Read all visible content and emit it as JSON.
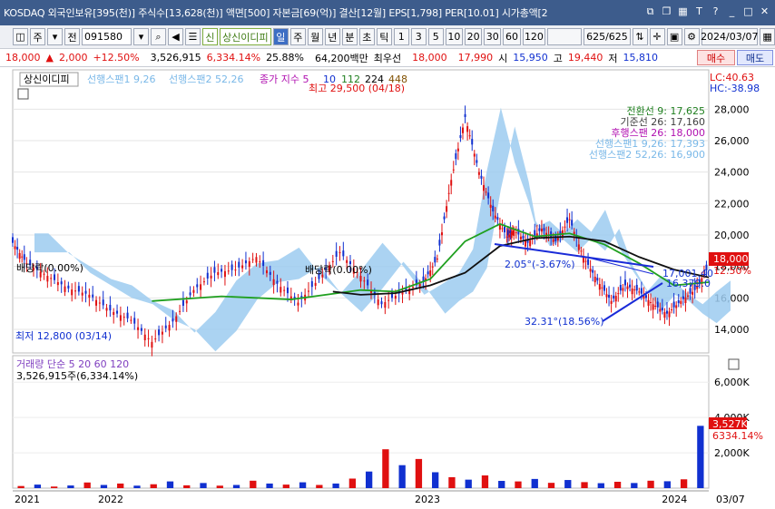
{
  "window": {
    "title": "KOSDAQ 외국인보유[395(천)] 주식수[13,628(천)] 액면[500] 자본금[69(억)] 결산[12월] EPS[1,798] PER[10.01] 시가총액[2",
    "ctrl_icons": [
      "restore-icon",
      "copy-icon",
      "grid-icon",
      "text-icon",
      "help-icon",
      "minimize-icon",
      "maximize-icon",
      "close-icon"
    ]
  },
  "toolbar": {
    "period": "주",
    "mode": "전",
    "code": "091580",
    "name": "상신이디피",
    "credit": "신",
    "intervals": [
      "일",
      "주",
      "월",
      "년",
      "분",
      "초",
      "틱"
    ],
    "numbers": [
      "1",
      "3",
      "5",
      "10",
      "20",
      "30",
      "60",
      "120"
    ],
    "count": "625/625",
    "date": "2024/03/07"
  },
  "info": {
    "price": "18,000",
    "change": "2,000",
    "change_pct": "+12.50%",
    "volume": "3,526,915",
    "vol_pct": "6,334.14%",
    "ratio": "25.88%",
    "amount": "64,200백만",
    "best_bid_label": "최우선",
    "ask": "18,000",
    "bid": "17,990",
    "open_label": "시",
    "open": "15,950",
    "high_label": "고",
    "high": "19,440",
    "low_label": "저",
    "low": "15,810",
    "buy": "매수",
    "sell": "매도"
  },
  "legend": {
    "name": "상신이디피",
    "span1": "선행스팬1 9,26",
    "span2": "선행스팬2 52,26",
    "ma_label": "종가 지수 5",
    "ma10": "10",
    "ma112": "112",
    "ma224": "224",
    "ma448": "448",
    "lc": "LC:40.63",
    "hc": "HC:-38.98"
  },
  "ichimoku_legend": [
    "전환선 9: 17,625",
    "기준선 26: 17,160",
    "후행스팬 26: 18,000",
    "선행스팬1 9,26: 17,393",
    "선행스팬2 52,26: 16,900"
  ],
  "annotations": {
    "high": "최고 29,500 (04/18)",
    "low": "최저 12,800 (03/14)",
    "div1": "배당락(0.00%)",
    "div2": "배당락(0.00%)",
    "angle1": "2.05°(-3.67%)",
    "angle2": "32.31°(18.56%)",
    "line1": "17,001.40",
    "line2": "16,379.0"
  },
  "price_badge": {
    "price": "18,000",
    "pct": "12.50%"
  },
  "volume": {
    "legend": "거래량 단순 5 20 60 120",
    "amount": "3,526,915주(6,334.14%)",
    "badge1": "3,527K",
    "badge2": "6334.14%"
  },
  "chart_data": {
    "type": "line",
    "title": "",
    "y_ticks": [
      14000,
      16000,
      18000,
      20000,
      22000,
      24000,
      26000,
      28000
    ],
    "ylim": [
      12500,
      30500
    ],
    "vol_ticks": [
      "2,000K",
      "4,000K",
      "6,000K"
    ],
    "vol_ylim": [
      0,
      7500
    ],
    "x_labels": [
      "2021",
      "2022",
      "2023",
      "2024",
      "03/07"
    ],
    "x_label_t": [
      0,
      0.12,
      0.575,
      0.93,
      1.0
    ],
    "series": [
      {
        "t": [
          0,
          0.02,
          0.05,
          0.08,
          0.11,
          0.14,
          0.17,
          0.2,
          0.23,
          0.26,
          0.29,
          0.32,
          0.35,
          0.38,
          0.41,
          0.44,
          0.47,
          0.5,
          0.53,
          0.56,
          0.59,
          0.61,
          0.63,
          0.65,
          0.67,
          0.69,
          0.71,
          0.72,
          0.74,
          0.76,
          0.78,
          0.8,
          0.82,
          0.84,
          0.86,
          0.88,
          0.9,
          0.92,
          0.94,
          0.96,
          0.98,
          1.0
        ],
        "values": [
          19500,
          18200,
          17400,
          16600,
          16200,
          15200,
          14600,
          13200,
          14500,
          16500,
          17600,
          17800,
          18600,
          16900,
          15700,
          17200,
          18900,
          17400,
          15600,
          16400,
          17000,
          18500,
          23500,
          27500,
          24000,
          21500,
          19900,
          20300,
          19500,
          20400,
          19600,
          21000,
          18600,
          17100,
          15800,
          16800,
          16400,
          15600,
          15000,
          15800,
          16500,
          18000
        ]
      },
      {
        "t": [
          0.2,
          0.3,
          0.4,
          0.5,
          0.55,
          0.6,
          0.65,
          0.7,
          0.75,
          0.8,
          0.85,
          0.9,
          0.95,
          1.0
        ],
        "values": [
          15800,
          16100,
          15900,
          16500,
          16400,
          17200,
          19600,
          20700,
          19900,
          20100,
          19400,
          18200,
          16800,
          17000
        ]
      },
      {
        "t": [
          0.46,
          0.5,
          0.55,
          0.6,
          0.65,
          0.7,
          0.75,
          0.8,
          0.85,
          0.9,
          0.95,
          1.0
        ],
        "values": [
          16400,
          16200,
          16300,
          16800,
          17600,
          19300,
          19800,
          19900,
          19600,
          18600,
          17800,
          17300
        ]
      }
    ],
    "volume_values": [
      120,
      200,
      90,
      150,
      320,
      180,
      260,
      140,
      220,
      380,
      160,
      290,
      140,
      180,
      420,
      260,
      200,
      330,
      180,
      260,
      540,
      940,
      2200,
      1300,
      1650,
      900,
      620,
      480,
      720,
      410,
      380,
      520,
      300,
      460,
      340,
      280,
      360,
      290,
      420,
      390,
      500,
      3527
    ]
  }
}
